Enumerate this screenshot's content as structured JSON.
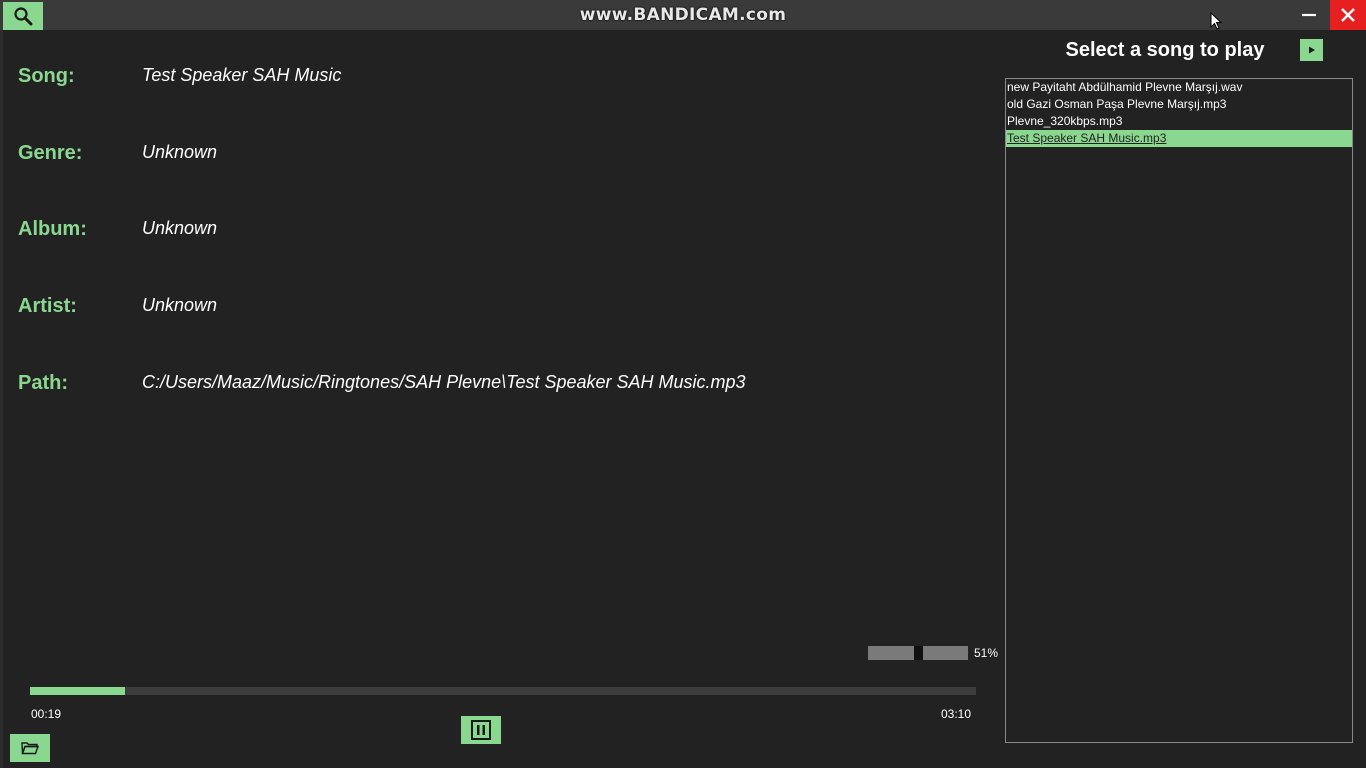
{
  "titlebar": {
    "watermark": "www.BANDICAM.com",
    "minimize_label": "—"
  },
  "colors": {
    "accent": "#8ad88f",
    "background": "#222222",
    "titlebar": "#3a3a3a",
    "close": "#e62020"
  },
  "info": {
    "song_label": "Song:",
    "song_value": "Test Speaker SAH Music",
    "genre_label": "Genre:",
    "genre_value": "Unknown",
    "album_label": "Album:",
    "album_value": "Unknown",
    "artist_label": "Artist:",
    "artist_value": "Unknown",
    "path_label": "Path:",
    "path_value": "C:/Users/Maaz/Music/Ringtones/SAH Plevne\\Test Speaker SAH Music.mp3"
  },
  "playlist": {
    "title": "Select a song to play",
    "items": [
      "new Payitaht Abdülhamid Plevne Marşıj.wav",
      "old Gazi Osman Paşa Plevne Marşıj.mp3",
      "Plevne_320kbps.mp3",
      "Test Speaker SAH Music.mp3"
    ],
    "selected_index": 3
  },
  "volume": {
    "label": "51%",
    "level": 0.51
  },
  "progress": {
    "current": "00:19",
    "total": "03:10",
    "fraction": 0.1
  },
  "icons": {
    "search": "search-icon",
    "close": "close-icon",
    "minimize": "minimize-icon",
    "play": "play-icon",
    "pause": "pause-icon",
    "folder": "folder-icon",
    "cursor": "mouse-cursor-icon"
  }
}
